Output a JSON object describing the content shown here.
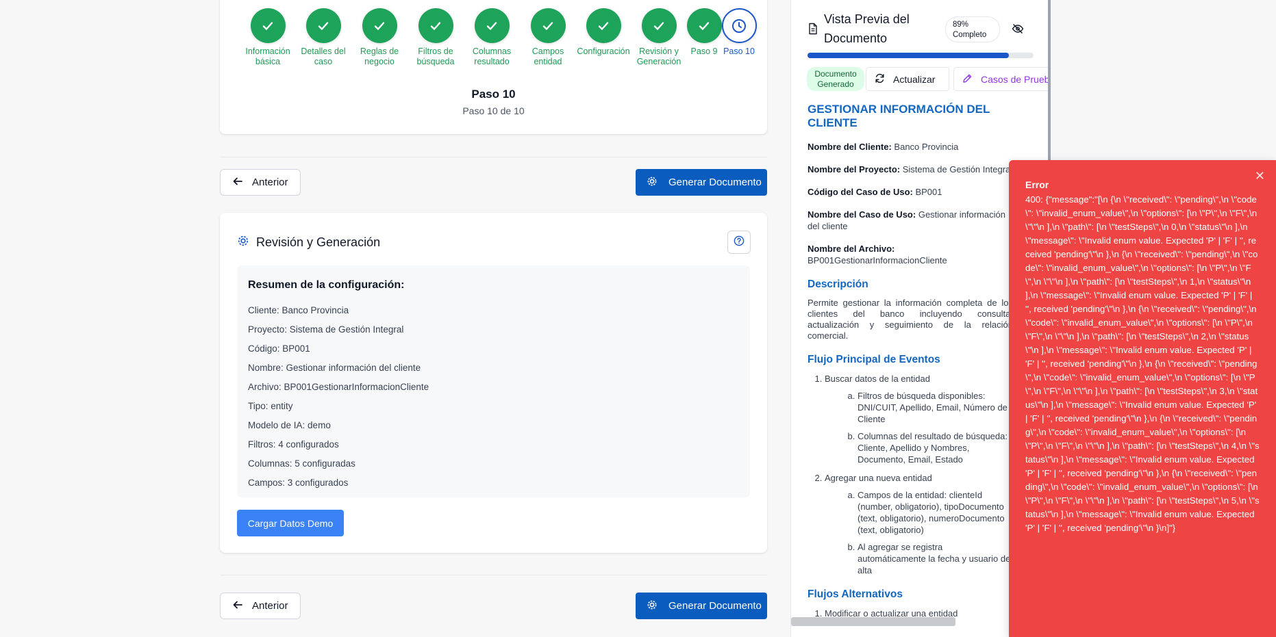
{
  "stepper": {
    "steps": [
      {
        "label": "Información básica",
        "state": "done"
      },
      {
        "label": "Detalles del caso",
        "state": "done"
      },
      {
        "label": "Reglas de negocio",
        "state": "done"
      },
      {
        "label": "Filtros de búsqueda",
        "state": "done"
      },
      {
        "label": "Columnas resultado",
        "state": "done"
      },
      {
        "label": "Campos entidad",
        "state": "done"
      },
      {
        "label": "Configuración",
        "state": "done"
      },
      {
        "label": "Revisión y Generación",
        "state": "done"
      },
      {
        "label": "Paso 9",
        "state": "done"
      },
      {
        "label": "Paso 10",
        "state": "current"
      }
    ],
    "title": "Paso 10",
    "subtitle": "Paso 10 de 10"
  },
  "nav": {
    "prev_label": "Anterior",
    "generate_label": "Generar Documento"
  },
  "review": {
    "title": "Revisión y Generación",
    "summary_title": "Resumen de la configuración:",
    "rows": [
      "Cliente: Banco Provincia",
      "Proyecto: Sistema de Gestión Integral",
      "Código: BP001",
      "Nombre: Gestionar información del cliente",
      "Archivo: BP001GestionarInformacionCliente",
      "Tipo: entity",
      "Modelo de IA: demo",
      "Filtros: 4 configurados",
      "Columnas: 5 configuradas",
      "Campos: 3 configurados"
    ],
    "demo_button": "Cargar Datos Demo"
  },
  "preview": {
    "title": "Vista Previa del Documento",
    "completion": "89% Completo",
    "progress": 0.89,
    "status": "Documento Generado",
    "refresh_label": "Actualizar",
    "tests_label": "Casos de Prueba",
    "doc_title": "GESTIONAR INFORMACIÓN DEL CLIENTE",
    "fields": [
      {
        "label": "Nombre del Cliente:",
        "value": "Banco Provincia"
      },
      {
        "label": "Nombre del Proyecto:",
        "value": "Sistema de Gestión Integral"
      },
      {
        "label": "Código del Caso de Uso:",
        "value": "BP001"
      },
      {
        "label": "Nombre del Caso de Uso:",
        "value": "Gestionar información del cliente"
      },
      {
        "label": "Nombre del Archivo:",
        "value": "BP001GestionarInformacionCliente"
      }
    ],
    "desc_heading": "Descripción",
    "desc_text": "Permite gestionar la información completa de los clientes del banco incluyendo consulta, actualización y seguimiento de la relación comercial.",
    "flow_heading": "Flujo Principal de Eventos",
    "flow": [
      {
        "text": "Buscar datos de la entidad",
        "sub": [
          "Filtros de búsqueda disponibles: DNI/CUIT, Apellido, Email, Número de Cliente",
          "Columnas del resultado de búsqueda: Cliente, Apellido y Nombres, Documento, Email, Estado"
        ]
      },
      {
        "text": "Agregar una nueva entidad",
        "sub": [
          "Campos de la entidad: clienteId (number, obligatorio), tipoDocumento (text, obligatorio), numeroDocumento (text, obligatorio)",
          "Al agregar se registra automáticamente la fecha y usuario de alta"
        ]
      }
    ],
    "alt_heading": "Flujos Alternativos",
    "alt": [
      "Modificar o actualizar una entidad"
    ]
  },
  "toast": {
    "title": "Error",
    "message": "400: {\"message\":\"[\\n {\\n \\\"received\\\": \\\"pending\\\",\\n \\\"code\\\": \\\"invalid_enum_value\\\",\\n \\\"options\\\": [\\n \\\"P\\\",\\n \\\"F\\\",\\n \\\"\\\"\\n ],\\n \\\"path\\\": [\\n \\\"testSteps\\\",\\n 0,\\n \\\"status\\\"\\n ],\\n \\\"message\\\": \\\"Invalid enum value. Expected 'P' | 'F' | '', received 'pending'\\\"\\n },\\n {\\n \\\"received\\\": \\\"pending\\\",\\n \\\"code\\\": \\\"invalid_enum_value\\\",\\n \\\"options\\\": [\\n \\\"P\\\",\\n \\\"F\\\",\\n \\\"\\\"\\n ],\\n \\\"path\\\": [\\n \\\"testSteps\\\",\\n 1,\\n \\\"status\\\"\\n ],\\n \\\"message\\\": \\\"Invalid enum value. Expected 'P' | 'F' | '', received 'pending'\\\"\\n },\\n {\\n \\\"received\\\": \\\"pending\\\",\\n \\\"code\\\": \\\"invalid_enum_value\\\",\\n \\\"options\\\": [\\n \\\"P\\\",\\n \\\"F\\\",\\n \\\"\\\"\\n ],\\n \\\"path\\\": [\\n \\\"testSteps\\\",\\n 2,\\n \\\"status\\\"\\n ],\\n \\\"message\\\": \\\"Invalid enum value. Expected 'P' | 'F' | '', received 'pending'\\\"\\n },\\n {\\n \\\"received\\\": \\\"pending\\\",\\n \\\"code\\\": \\\"invalid_enum_value\\\",\\n \\\"options\\\": [\\n \\\"P\\\",\\n \\\"F\\\",\\n \\\"\\\"\\n ],\\n \\\"path\\\": [\\n \\\"testSteps\\\",\\n 3,\\n \\\"status\\\"\\n ],\\n \\\"message\\\": \\\"Invalid enum value. Expected 'P' | 'F' | '', received 'pending'\\\"\\n },\\n {\\n \\\"received\\\": \\\"pending\\\",\\n \\\"code\\\": \\\"invalid_enum_value\\\",\\n \\\"options\\\": [\\n \\\"P\\\",\\n \\\"F\\\",\\n \\\"\\\"\\n ],\\n \\\"path\\\": [\\n \\\"testSteps\\\",\\n 4,\\n \\\"status\\\"\\n ],\\n \\\"message\\\": \\\"Invalid enum value. Expected 'P' | 'F' | '', received 'pending'\\\"\\n },\\n {\\n \\\"received\\\": \\\"pending\\\",\\n \\\"code\\\": \\\"invalid_enum_value\\\",\\n \\\"options\\\": [\\n \\\"P\\\",\\n \\\"F\\\",\\n \\\"\\\"\\n ],\\n \\\"path\\\": [\\n \\\"testSteps\\\",\\n 5,\\n \\\"status\\\"\\n ],\\n \\\"message\\\": \\\"Invalid enum value. Expected 'P' | 'F' | '', received 'pending'\\\"\\n }\\n]\"}"
  },
  "colors": {
    "done": "#1ea35a",
    "current": "#1c57c9",
    "primary_button": "#0b5cbf",
    "error": "#ef4444"
  }
}
